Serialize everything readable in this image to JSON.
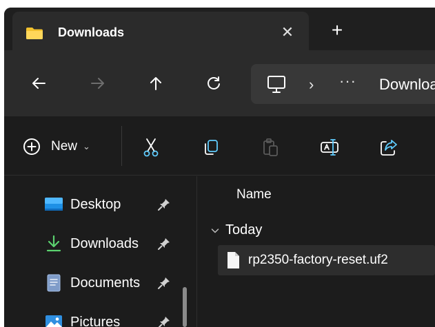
{
  "tab": {
    "title": "Downloads",
    "close_symbol": "✕",
    "new_tab_symbol": "+"
  },
  "nav": {
    "back_icon": "arrow-left-icon",
    "forward_icon": "arrow-right-icon",
    "up_icon": "arrow-up-icon",
    "refresh_icon": "refresh-icon"
  },
  "address": {
    "separator": "›",
    "more": "···",
    "crumb": "Downloads"
  },
  "commands": {
    "new_label": "New",
    "new_chevron": "⌄",
    "icons": [
      "cut-icon",
      "copy-icon",
      "paste-icon",
      "rename-icon",
      "share-icon"
    ]
  },
  "sidebar": {
    "items": [
      {
        "label": "Desktop",
        "icon": "desktop-folder-icon"
      },
      {
        "label": "Downloads",
        "icon": "download-arrow-icon"
      },
      {
        "label": "Documents",
        "icon": "document-icon"
      },
      {
        "label": "Pictures",
        "icon": "pictures-icon"
      }
    ]
  },
  "content": {
    "column_name": "Name",
    "group": "Today",
    "files": [
      {
        "name": "rp2350-factory-reset.uf2",
        "icon": "file-icon"
      }
    ]
  },
  "colors": {
    "background": "#1c1c1c",
    "tab_active": "#2b2b2b",
    "address_bg": "#383838",
    "accent_blue": "#60cdff",
    "folder_yellow": "#f2c12e",
    "download_green": "#5bd26f"
  }
}
